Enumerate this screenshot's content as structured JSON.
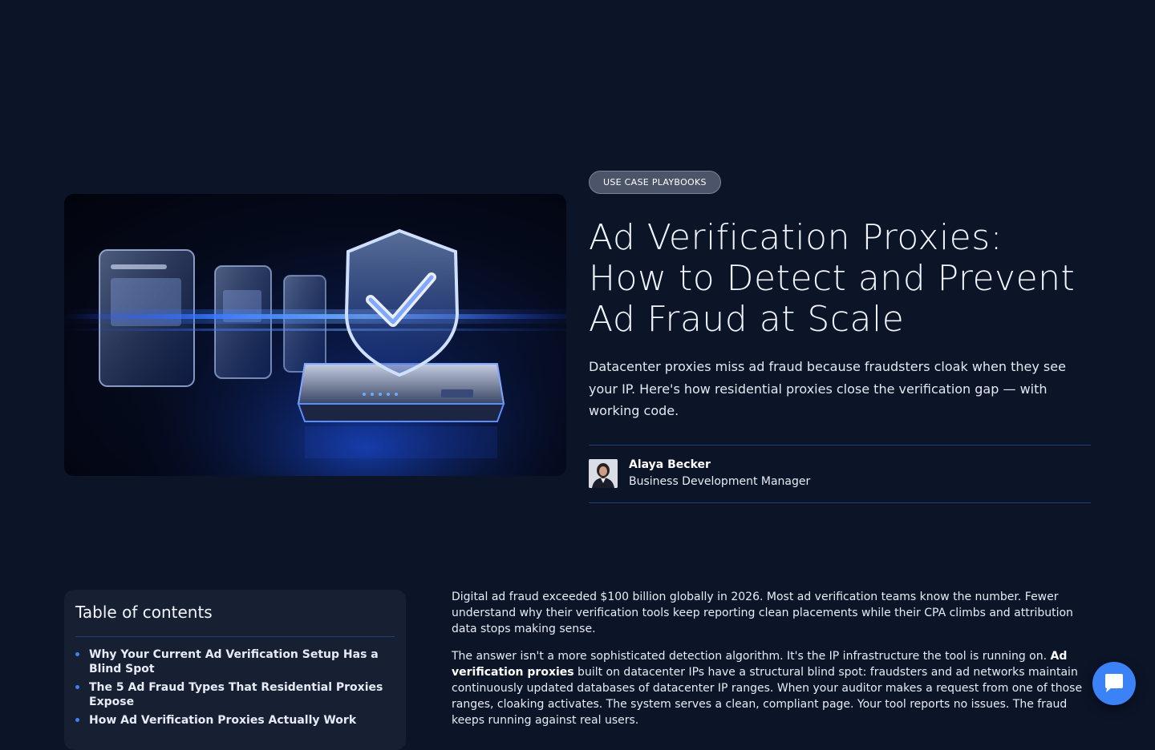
{
  "hero": {
    "category": "USE CASE PLAYBOOKS",
    "title": "Ad Verification Proxies: How to Detect and Prevent Ad Fraud at Scale",
    "subtitle": "Datacenter proxies miss ad fraud because fraudsters cloak when they see your IP. Here's how residential proxies close the verification gap — with working code.",
    "image_icon": "shield-checkmark-illustration"
  },
  "author": {
    "name": "Alaya Becker",
    "role": "Business Development Manager"
  },
  "toc": {
    "title": "Table of contents",
    "items": [
      "Why Your Current Ad Verification Setup Has a Blind Spot",
      "The 5 Ad Fraud Types That Residential Proxies Expose",
      "How Ad Verification Proxies Actually Work"
    ]
  },
  "article": {
    "p1": "Digital ad fraud exceeded $100 billion globally in 2026. Most ad verification teams know the number. Fewer understand why their verification tools keep reporting clean placements while their CPA climbs and attribution data stops making sense.",
    "p2_a": "The answer isn't a more sophisticated detection algorithm. It's the IP infrastructure the tool is running on. ",
    "p2_bold": "Ad verification proxies",
    "p2_b": " built on datacenter IPs have a structural blind spot: fraudsters and ad networks maintain continuously updated databases of datacenter IP ranges. When your auditor makes a request from one of those ranges, cloaking activates. The system serves a clean, compliant page. Your tool reports no issues. The fraud keeps running against real users."
  },
  "chat": {
    "icon": "chat-bubble-icon"
  },
  "colors": {
    "background": "#0c1428",
    "accent": "#3b82f6",
    "divider": "#1f3d7a",
    "card": "#171f33"
  }
}
